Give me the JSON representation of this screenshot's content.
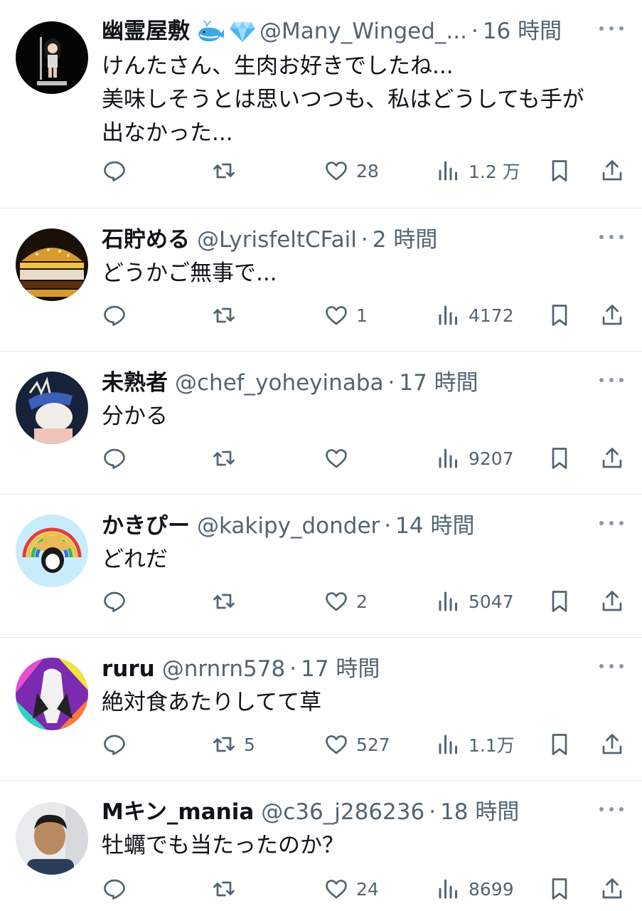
{
  "tweets": [
    {
      "name": "幽霊屋敷",
      "badges": [
        "whale-emoji",
        "gem-emoji"
      ],
      "handle": "@Many_Winged_...",
      "time": "16 時間",
      "lines": [
        "けんたさん、生肉お好きでしたね...",
        "美味しそうとは思いつつも、私はどうしても手が",
        "出なかった..."
      ],
      "replies": "",
      "retweets": "",
      "likes": "28",
      "views": "1.2 万"
    },
    {
      "name": "石貯める",
      "badges": [],
      "handle": "@LyrisfeltCFail",
      "time": "2 時間",
      "lines": [
        "どうかご無事で..."
      ],
      "replies": "",
      "retweets": "",
      "likes": "1",
      "views": "4172"
    },
    {
      "name": "未熟者",
      "badges": [],
      "handle": "@chef_yoheyinaba",
      "time": "17 時間",
      "lines": [
        "分かる"
      ],
      "replies": "",
      "retweets": "",
      "likes": "",
      "views": "9207"
    },
    {
      "name": "かきぴー",
      "badges": [],
      "handle": "@kakipy_donder",
      "time": "14 時間",
      "lines": [
        "どれだ"
      ],
      "replies": "",
      "retweets": "",
      "likes": "2",
      "views": "5047"
    },
    {
      "name": "ruru",
      "badges": [],
      "handle": "@nrnrn578",
      "time": "17 時間",
      "lines": [
        "絶対食あたりしてて草"
      ],
      "replies": "",
      "retweets": "5",
      "likes": "527",
      "views": "1.1万"
    },
    {
      "name": "Mキン_mania",
      "badges": [],
      "handle": "@c36_j286236",
      "time": "18 時間",
      "lines": [
        "牡蠣でも当たったのか？"
      ],
      "replies": "",
      "retweets": "",
      "likes": "24",
      "views": "8699"
    }
  ],
  "separator": "·",
  "icons": {
    "reply": "reply-icon",
    "retweet": "retweet-icon",
    "like": "heart-icon",
    "views": "views-icon",
    "bookmark": "bookmark-icon",
    "share": "share-icon",
    "more": "more-icon"
  },
  "colors": {
    "text": "#0f1419",
    "secondary": "#536471",
    "divider": "#e6e9eb"
  }
}
